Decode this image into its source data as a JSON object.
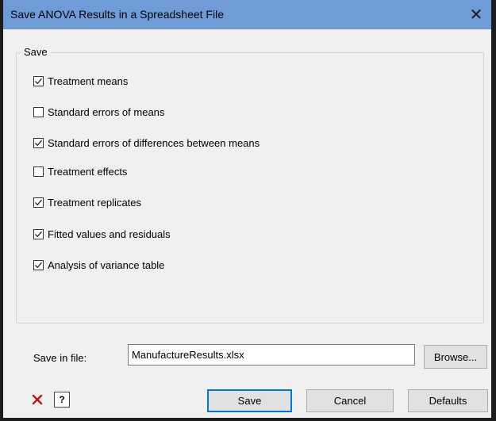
{
  "window": {
    "title": "Save ANOVA Results in a Spreadsheet File"
  },
  "group": {
    "label": "Save"
  },
  "options": [
    {
      "label": "Treatment means",
      "checked": true
    },
    {
      "label": "Standard errors of means",
      "checked": false
    },
    {
      "label": "Standard errors of differences between means",
      "checked": true
    },
    {
      "label": "Treatment effects",
      "checked": false
    },
    {
      "label": "Treatment replicates",
      "checked": true
    },
    {
      "label": "Fitted values and residuals",
      "checked": true
    },
    {
      "label": "Analysis of variance table",
      "checked": true
    }
  ],
  "file": {
    "label": "Save in file:",
    "value": "ManufactureResults.xlsx",
    "browse_label": "Browse..."
  },
  "footer": {
    "clear_icon": "red-x-icon",
    "help_icon": "help-question-icon",
    "save_label": "Save",
    "cancel_label": "Cancel",
    "defaults_label": "Defaults"
  },
  "colors": {
    "titlebar": "#6f9cd6",
    "clear_icon": "#c0141a",
    "default_button_border": "#0078d7"
  }
}
